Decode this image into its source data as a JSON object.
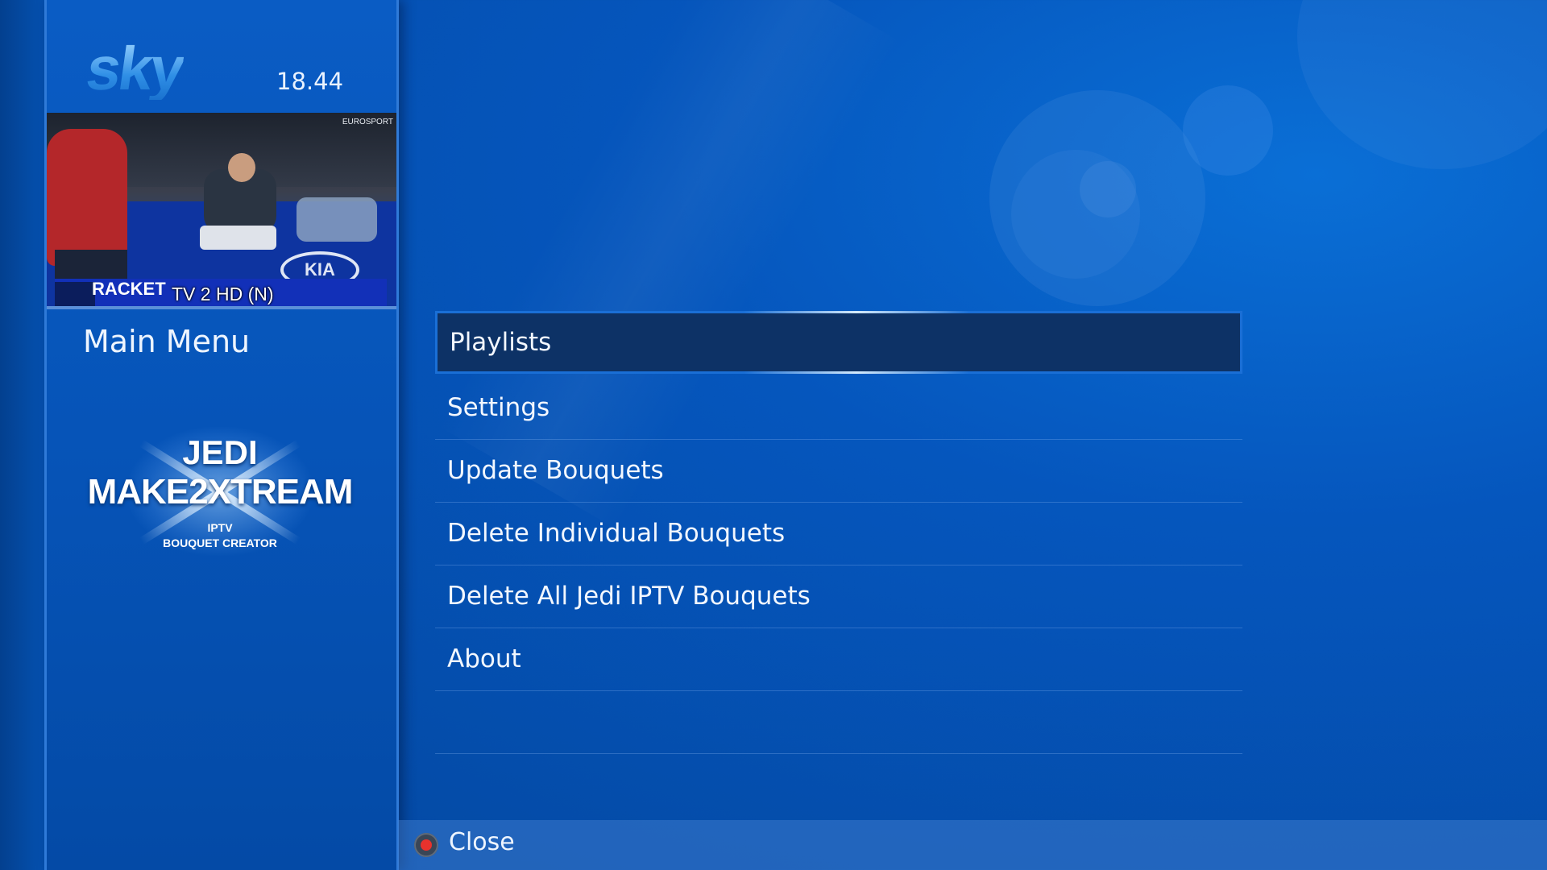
{
  "header": {
    "logo_text": "sky",
    "clock": "18.44"
  },
  "preview": {
    "brand": "EUROSPORT",
    "ticker_text": "RACKET",
    "channel_name": "TV 2 HD (N)",
    "kia_text": "KIA"
  },
  "panel": {
    "title": "Main Menu"
  },
  "plugin_logo": {
    "line1": "JEDI",
    "line2": "MAKE2XTREAM",
    "line3": "IPTV",
    "line4": "BOUQUET CREATOR"
  },
  "menu": {
    "items": [
      {
        "label": "Playlists",
        "selected": true
      },
      {
        "label": "Settings"
      },
      {
        "label": "Update Bouquets"
      },
      {
        "label": "Delete Individual Bouquets"
      },
      {
        "label": "Delete All Jedi IPTV Bouquets"
      },
      {
        "label": "About"
      }
    ]
  },
  "footer": {
    "close_label": "Close",
    "close_button_color": "#e8322d"
  },
  "colors": {
    "background": "#0556bd",
    "selected_item": "#0d3266",
    "selected_border": "#1a6fd6"
  }
}
